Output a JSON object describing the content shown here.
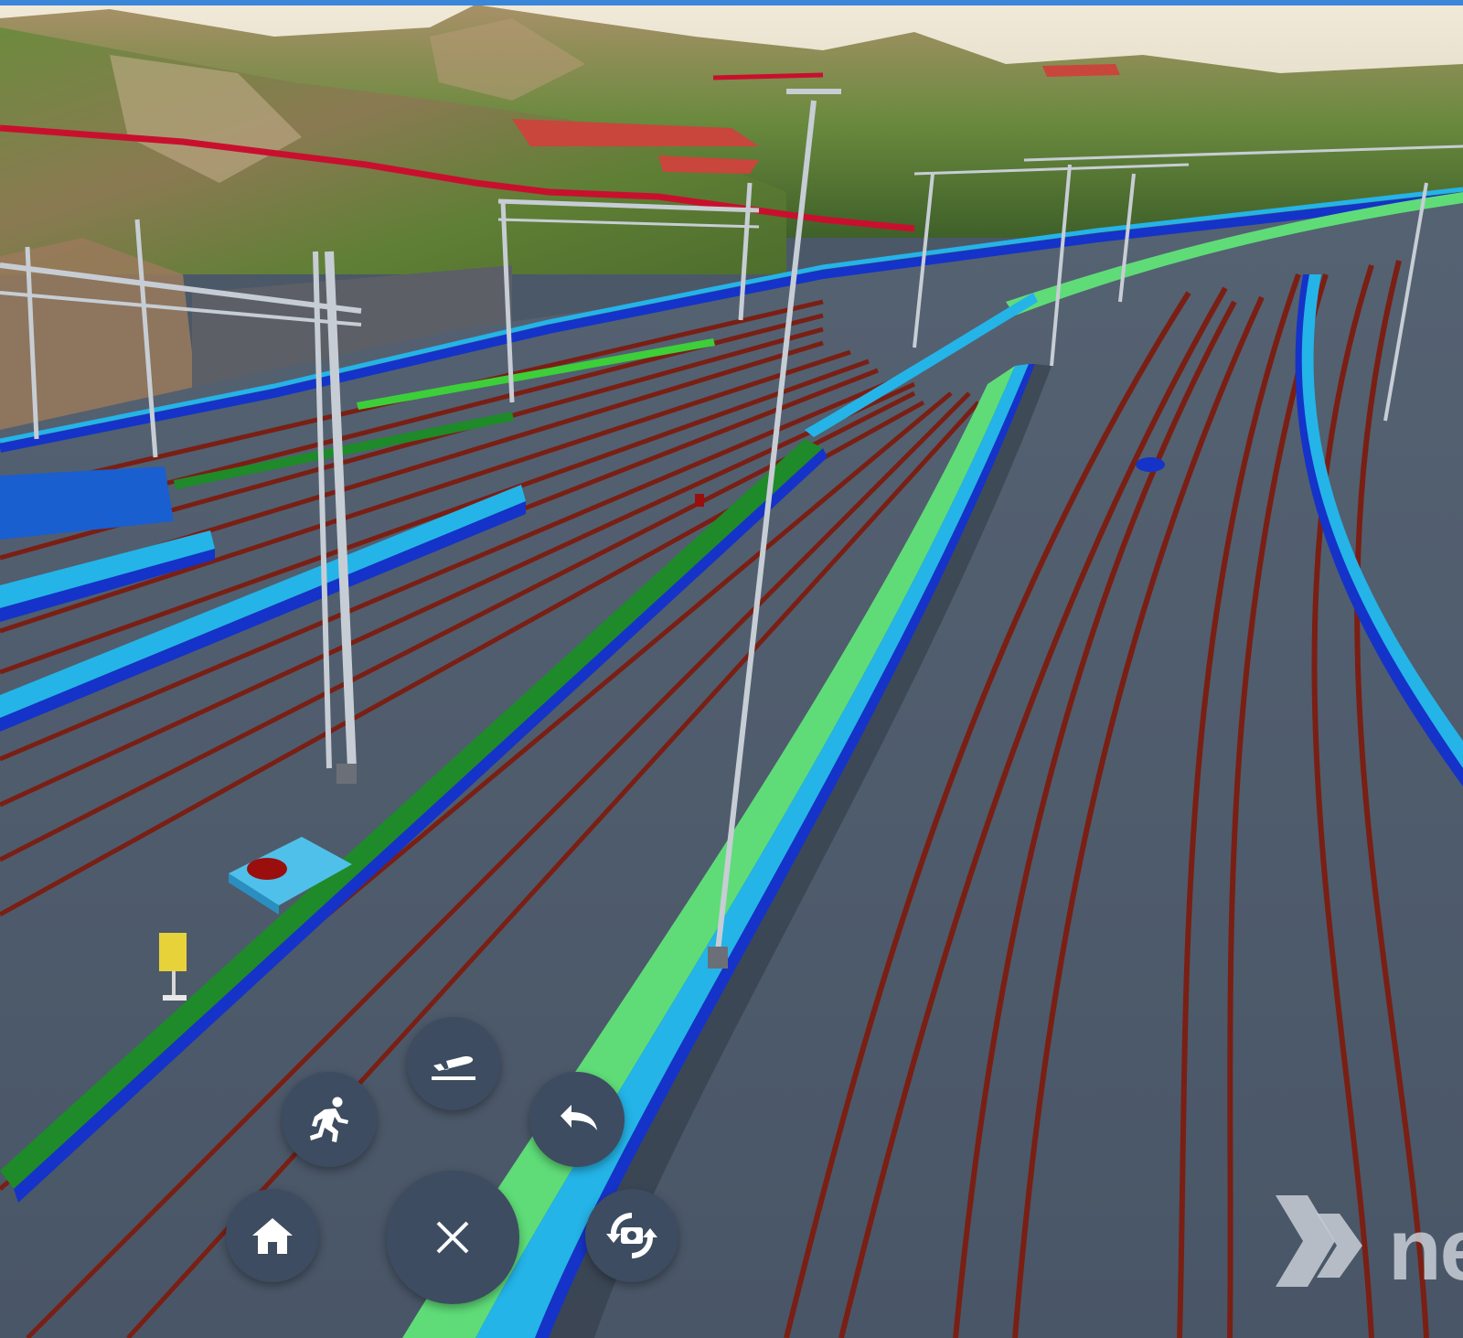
{
  "viewer": {
    "scene_description_name": "railway-yard-3d-view",
    "colors": {
      "top_bar": "#3a86d8",
      "ground": "#4b5868",
      "rail": "#7a1f14",
      "platform_green": "#1f8a2a",
      "platform_light_green": "#5fdc78",
      "platform_cyan": "#24b4e8",
      "platform_blue": "#1533c8",
      "fab_background": "#3d4c60",
      "fab_icon": "#ffffff"
    }
  },
  "navigation_controls": [
    {
      "id": "takeoff",
      "icon": "airplane-takeoff-icon"
    },
    {
      "id": "walk",
      "icon": "walking-person-icon"
    },
    {
      "id": "undo",
      "icon": "undo-arrow-icon"
    },
    {
      "id": "home",
      "icon": "home-icon"
    },
    {
      "id": "close",
      "icon": "close-icon"
    },
    {
      "id": "rotate-camera",
      "icon": "rotate-camera-icon"
    }
  ],
  "watermark": {
    "text": "ne"
  }
}
